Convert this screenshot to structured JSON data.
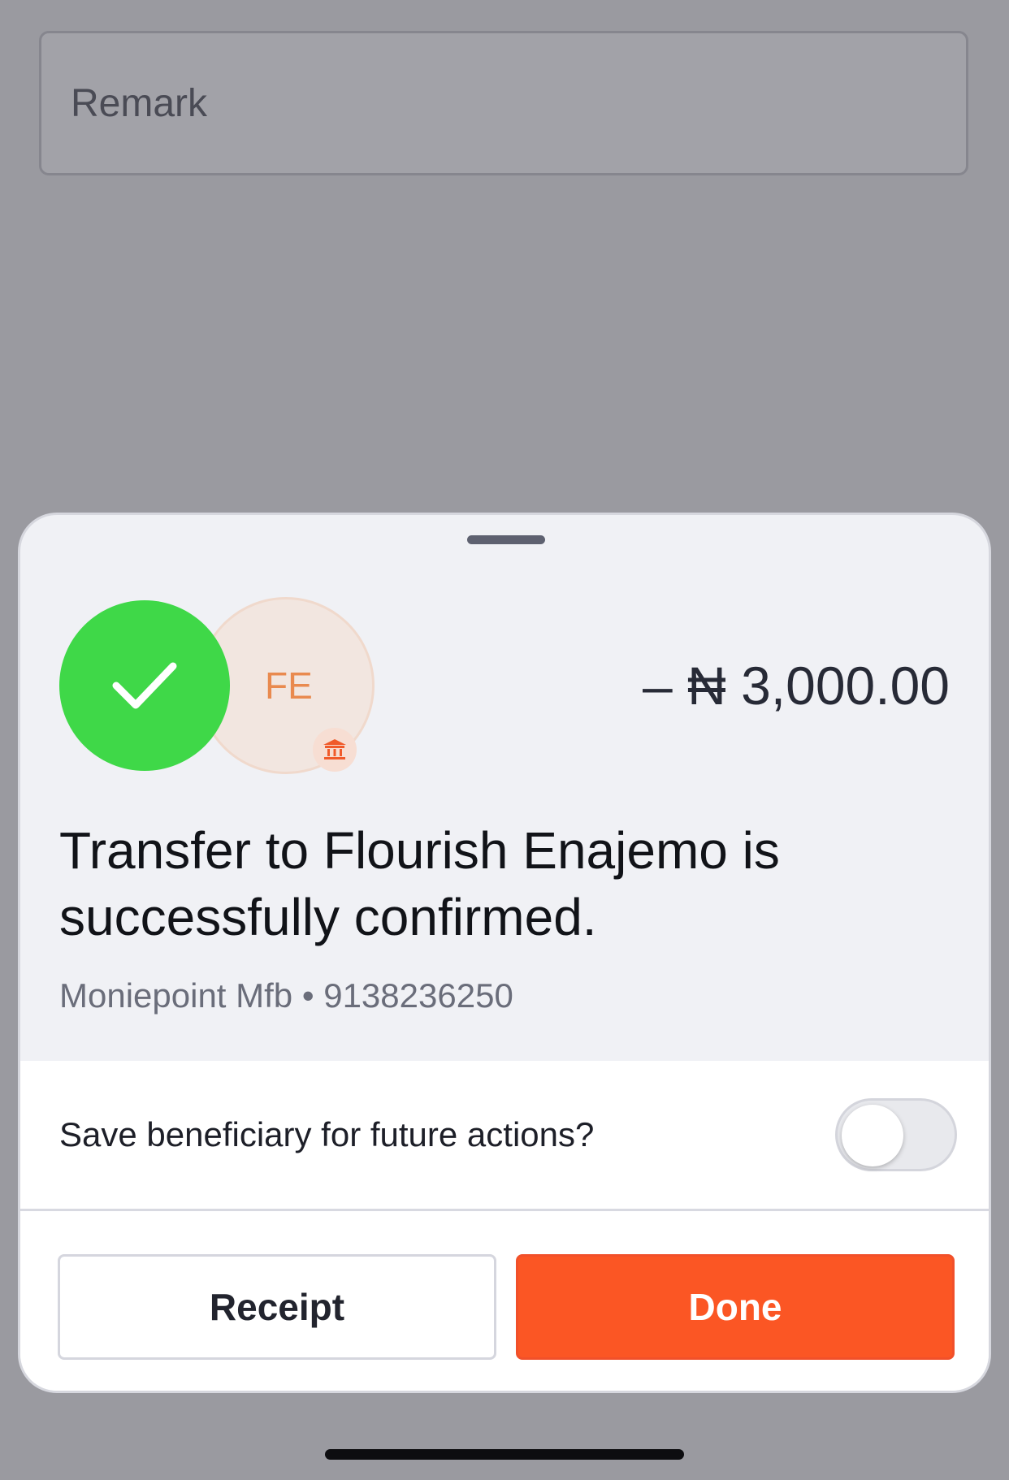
{
  "form": {
    "remark_placeholder": "Remark"
  },
  "sheet": {
    "recipient_initials": "FE",
    "amount": "– ₦ 3,000.00",
    "headline": "Transfer to Flourish Enajemo is successfully confirmed.",
    "bank_name": "Moniepoint Mfb",
    "separator": "•",
    "account_number": "9138236250",
    "save_beneficiary_label": "Save beneficiary for future actions?",
    "save_beneficiary_on": false,
    "receipt_label": "Receipt",
    "done_label": "Done"
  },
  "icons": {
    "success": "checkmark-icon",
    "bank": "bank-icon"
  },
  "colors": {
    "success_green": "#3fd848",
    "accent_orange": "#fb5624",
    "initials_orange": "#e98a4f"
  }
}
